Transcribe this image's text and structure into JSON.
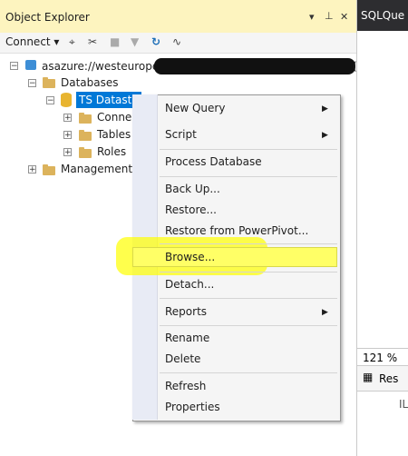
{
  "object_explorer": {
    "title": "Object Explorer",
    "pin_controls": [
      "▾",
      "⊥",
      "✕"
    ],
    "toolbar": {
      "connect_label": "Connect ▾",
      "tool_icons": [
        "plug-icon",
        "disconnect-icon",
        "stop-icon",
        "filter-icon",
        "refresh-icon",
        "activity-icon"
      ]
    },
    "tree": {
      "server": "asazure://westeurope",
      "server_suffix": "(",
      "databases": "Databases",
      "database_selected": "TS Datastor",
      "children": [
        "Conne",
        "Tables",
        "Roles"
      ],
      "management": "Management"
    }
  },
  "right_pane": {
    "tab_label": "SQLQue",
    "zoom": "121 %",
    "results_label": "Res",
    "column_label": "IL"
  },
  "context_menu": {
    "items": [
      {
        "label": "New Query",
        "submenu": true
      },
      {
        "label": "Script",
        "submenu": true
      },
      {
        "label": "Process Database",
        "submenu": false
      },
      {
        "label": "Back Up...",
        "submenu": false
      },
      {
        "label": "Restore...",
        "submenu": false
      },
      {
        "label": "Restore from PowerPivot...",
        "submenu": false
      },
      {
        "label": "Browse...",
        "submenu": false,
        "highlighted": true
      },
      {
        "label": "Detach...",
        "submenu": false
      },
      {
        "label": "Reports",
        "submenu": true
      },
      {
        "label": "Rename",
        "submenu": false
      },
      {
        "label": "Delete",
        "submenu": false
      },
      {
        "label": "Refresh",
        "submenu": false
      },
      {
        "label": "Properties",
        "submenu": false
      }
    ]
  },
  "colors": {
    "titlebar": "#fdf4bf",
    "selection": "#0078d7",
    "highlight": "#ffff66"
  }
}
